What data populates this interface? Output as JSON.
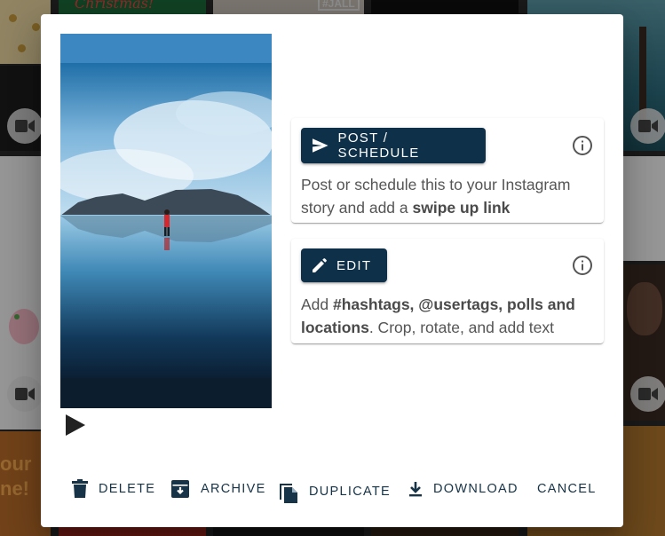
{
  "background": {
    "tile_texts": {
      "christmas": "Christmas!",
      "tag": "#JALL",
      "promo_line_1": "our",
      "promo_line_2": "ne!"
    }
  },
  "modal": {
    "post_card": {
      "button_label": "POST / SCHEDULE",
      "text_plain": "Post or schedule this to your Instagram story and add a ",
      "text_bold": "swipe up link"
    },
    "edit_card": {
      "button_label": "EDIT",
      "text_prefix": "Add ",
      "text_bold": "#hashtags, @usertags, polls and locations",
      "text_suffix": ". Crop, rotate, and add text"
    },
    "actions": {
      "delete": "DELETE",
      "archive": "ARCHIVE",
      "duplicate": "DUPLICATE",
      "download": "DOWNLOAD",
      "cancel": "CANCEL"
    }
  },
  "colors": {
    "primary": "#0f3049",
    "action_text": "#163347",
    "info_icon": "#555555"
  }
}
